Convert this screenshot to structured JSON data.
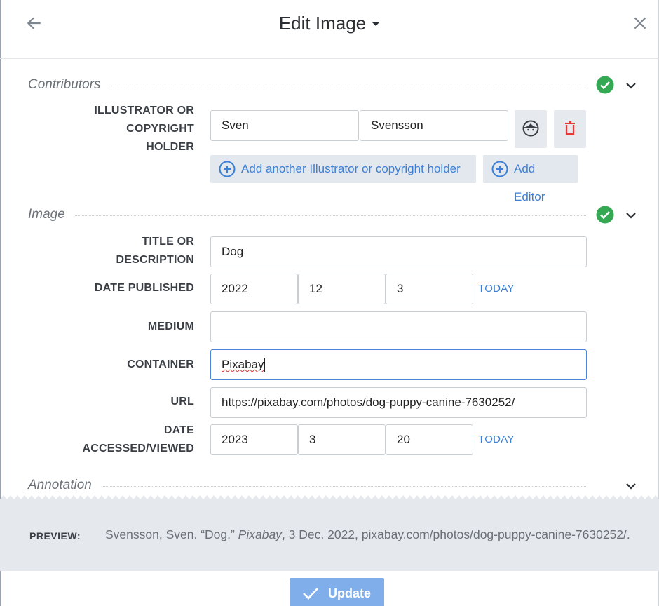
{
  "header": {
    "title": "Edit Image"
  },
  "contributors": {
    "section_title": "Contributors",
    "role_label": "ILLUSTRATOR OR COPYRIGHT HOLDER",
    "role_label_lines": [
      "ILLUSTRATOR OR",
      "COPYRIGHT",
      "HOLDER"
    ],
    "first_name": "Sven",
    "last_name": "Svensson",
    "add_another_label": "Add another Illustrator or copyright holder",
    "add_editor_label": "Add Editor"
  },
  "image": {
    "section_title": "Image",
    "title_label_lines": [
      "TITLE OR",
      "DESCRIPTION"
    ],
    "title_value": "Dog",
    "date_published_label": "DATE PUBLISHED",
    "date_published": {
      "year": "2022",
      "month": "12",
      "day": "3"
    },
    "today_label": "TODAY",
    "medium_label": "MEDIUM",
    "medium_value": "",
    "container_label": "CONTAINER",
    "container_value": "Pixabay",
    "url_label": "URL",
    "url_value": "https://pixabay.com/photos/dog-puppy-canine-7630252/",
    "accessed_label_lines": [
      "DATE",
      "ACCESSED/VIEWED"
    ],
    "date_accessed": {
      "year": "2023",
      "month": "3",
      "day": "20"
    }
  },
  "annotation": {
    "section_title": "Annotation"
  },
  "preview": {
    "label": "PREVIEW:",
    "citation_before": "Svensson, Sven. “Dog.” ",
    "citation_container": "Pixabay",
    "citation_after": ", 3 Dec. 2022, pixabay.com/photos/dog-puppy-canine-7630252/."
  },
  "footer": {
    "update_label": "Update"
  },
  "colors": {
    "accent": "#3b7fd6",
    "success": "#34a853",
    "danger": "#e53935",
    "preview_bg": "#e5e8ec"
  }
}
